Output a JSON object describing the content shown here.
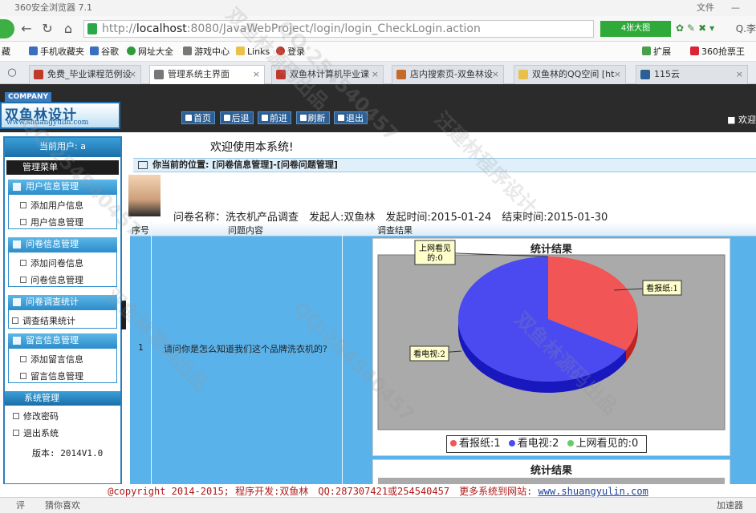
{
  "browser": {
    "title": "360安全浏览器 7.1",
    "menu_file": "文件",
    "url_prefix": "http://",
    "url_host": "localhost",
    "url_rest": ":8080/JavaWebProject/login/login_CheckLogin.action",
    "kbtn_label": "4张大图",
    "search_label": "Q.李",
    "bookmarks": [
      "藏",
      "手机收藏夹",
      "谷歌",
      "网址大全",
      "游戏中心",
      "Links",
      "登录",
      "扩展",
      "360抢票王"
    ],
    "tabs": [
      {
        "label": "免费_毕业课程范例设"
      },
      {
        "label": "管理系统主界面"
      },
      {
        "label": "双鱼林计算机毕业课"
      },
      {
        "label": "店内搜索页-双鱼林设"
      },
      {
        "label": "双鱼林的QQ空间 [ht"
      },
      {
        "label": "115云"
      }
    ],
    "status_left": "评",
    "status_guess": "猜你喜欢",
    "status_accel": "加速器",
    "colors": {
      "brand_green": "#2fa93a",
      "link_blue": "#1a3f9a"
    }
  },
  "header": {
    "company": "COMPANY",
    "logo_text": "双鱼林设计",
    "logo_url": "www.shuangyulin.com",
    "nav": [
      "首页",
      "后退",
      "前进",
      "刷新",
      "退出"
    ],
    "welcome_right": "欢迎"
  },
  "sidebar": {
    "current_user": "当前用户: a",
    "menu_title": "管理菜单",
    "groups": [
      {
        "title": "用户信息管理",
        "items": [
          "添加用户信息",
          "用户信息管理"
        ]
      },
      {
        "title": "问卷信息管理",
        "items": [
          "添加问卷信息",
          "问卷信息管理"
        ]
      },
      {
        "title": "问卷调查统计",
        "items": [
          "调查结果统计"
        ]
      },
      {
        "title": "留言信息管理",
        "items": [
          "添加留言信息",
          "留言信息管理"
        ]
      }
    ],
    "system": {
      "title": "系统管理",
      "items": [
        "修改密码",
        "退出系统"
      ]
    },
    "version": "版本: 2014V1.0"
  },
  "main": {
    "welcome": "欢迎使用本系统!",
    "location": "你当前的位置: [问卷信息管理]-[问卷问题管理]",
    "survey_info": "问卷名称：洗衣机产品调查　发起人:双鱼林　发起时间:2015-01-24　结束时间:2015-01-30",
    "table": {
      "headers": [
        "序号",
        "问题内容",
        "调查结果"
      ],
      "rows": [
        {
          "no": "1",
          "question": "请问你是怎么知道我们这个品牌洗衣机的?"
        }
      ]
    }
  },
  "chart_data": [
    {
      "type": "pie",
      "title": "统计结果",
      "categories": [
        "看报纸",
        "看电视",
        "上网看见的"
      ],
      "values": [
        1,
        2,
        0
      ],
      "slice_labels": [
        "看报纸:1",
        "看电视:2",
        "上网看见\n的:0"
      ],
      "legend": [
        "看报纸:1",
        "看电视:2",
        "上网看见的:0"
      ],
      "legend_position": "bottom",
      "colors": [
        "#f15555",
        "#4a4af0",
        "#66cc66"
      ],
      "plot_background": "#aaaaaa"
    },
    {
      "type": "pie",
      "title": "统计结果"
    }
  ],
  "footer": {
    "copyright": "@copyright 2014-2015; 程序开发:双鱼林　QQ:287307421或254540457　更多系统到网站:",
    "site": "www.shuangyulin.com"
  },
  "watermark": [
    "汪建林程序设计",
    "QQ:254540457",
    "双鱼林源码出品"
  ]
}
